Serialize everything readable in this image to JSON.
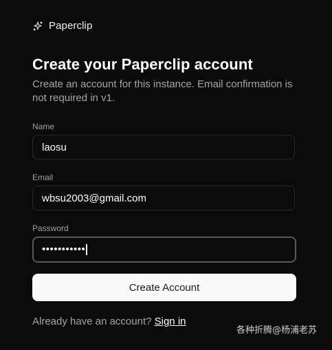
{
  "brand": {
    "name": "Paperclip",
    "icon": "sparkles-icon"
  },
  "header": {
    "title": "Create your Paperclip account",
    "subtitle": "Create an account for this instance. Email confirmation is not required in v1."
  },
  "form": {
    "name": {
      "label": "Name",
      "value": "laosu"
    },
    "email": {
      "label": "Email",
      "value": "wbsu2003@gmail.com"
    },
    "password": {
      "label": "Password",
      "masked_value": "•••••••••••"
    },
    "submit_label": "Create Account"
  },
  "footer": {
    "prompt": "Already have an account?",
    "link_label": "Sign in"
  },
  "watermark": "各种折腾@杨浦老苏",
  "colors": {
    "background": "#0b0b0c",
    "text": "#ffffff",
    "muted": "#a6a6a6",
    "border": "#2a2a2a",
    "button_bg": "#fafafa"
  }
}
